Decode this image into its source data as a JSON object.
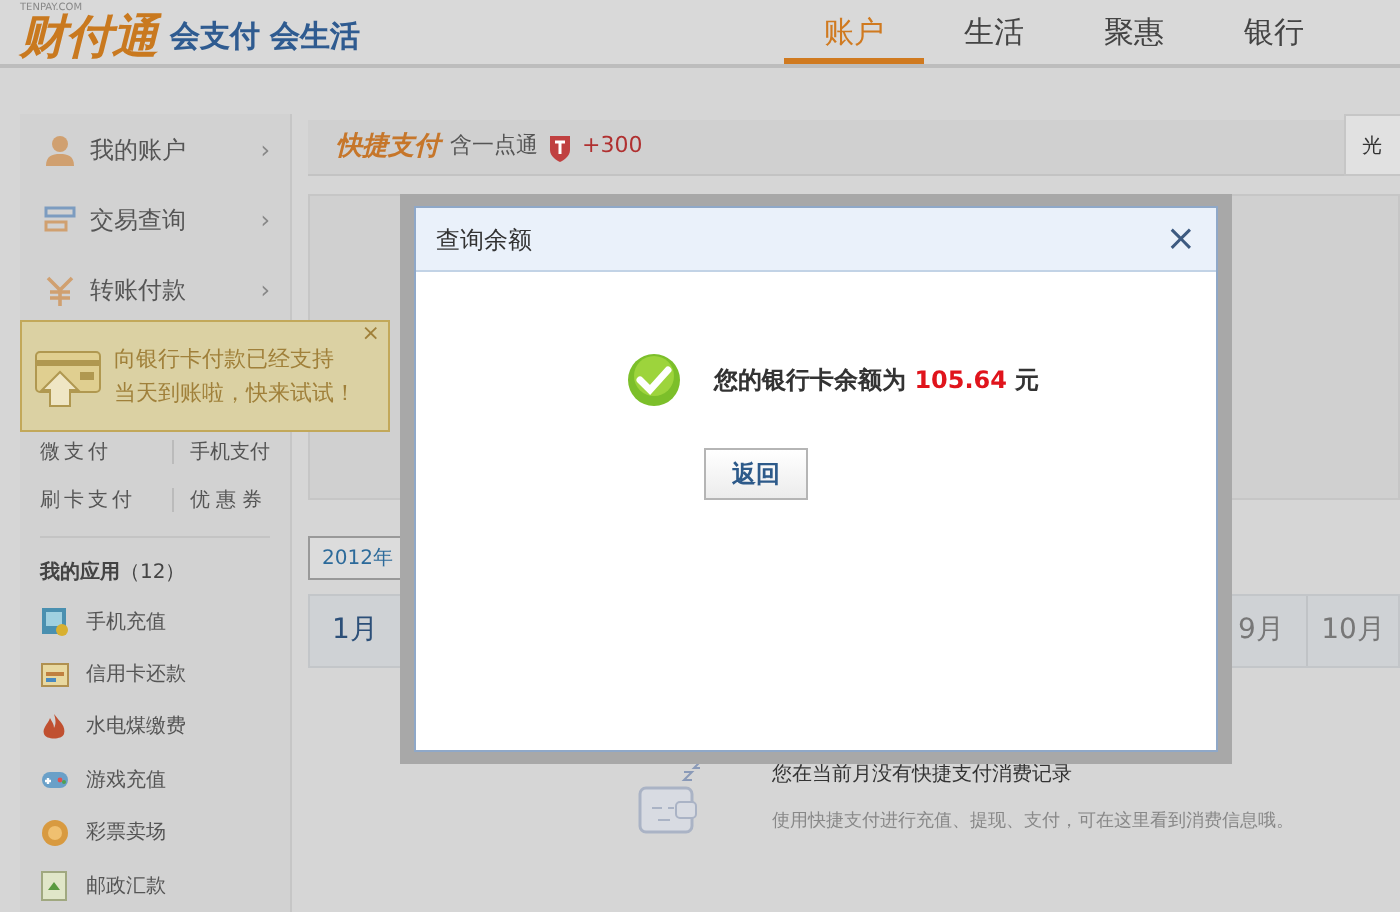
{
  "header": {
    "logo_small": "TENPAY.COM",
    "logo": "财付通",
    "slogan": "会支付 会生活",
    "nav": [
      {
        "label": "账户",
        "selected": true
      },
      {
        "label": "生活",
        "selected": false
      },
      {
        "label": "聚惠",
        "selected": false
      },
      {
        "label": "银行",
        "selected": false
      }
    ]
  },
  "sidebar": {
    "items": [
      {
        "label": "我的账户",
        "kind": "person",
        "chevron": "›"
      },
      {
        "label": "交易查询",
        "kind": "list",
        "chevron": "›"
      },
      {
        "label": "转账付款",
        "kind": "yen",
        "chevron": "›"
      }
    ],
    "tooltip": {
      "lines": [
        "向银行卡付款已经支持",
        "当天到账啦，快来试试！"
      ],
      "close": "×"
    },
    "links": [
      [
        "微支付",
        "手机支付"
      ],
      [
        "刷卡支付",
        "优惠券"
      ]
    ],
    "apps_title": "我的应用",
    "apps_count": "（12）",
    "apps": [
      {
        "label": "手机充值",
        "kind": "phone"
      },
      {
        "label": "信用卡还款",
        "kind": "card"
      },
      {
        "label": "水电煤缴费",
        "kind": "flame"
      },
      {
        "label": "游戏充值",
        "kind": "game"
      },
      {
        "label": "彩票卖场",
        "kind": "lottery"
      },
      {
        "label": "邮政汇款",
        "kind": "post"
      }
    ]
  },
  "main": {
    "brand": "快捷支付",
    "brand_note": "含一点通",
    "bonus": "+300",
    "side_tab": "光",
    "year_tabs": [
      {
        "label": "2012年",
        "selected": true
      }
    ],
    "months_left": [
      "1月"
    ],
    "months_right": [
      "9月",
      "10月"
    ],
    "empty": {
      "title": "您在当前月没有快捷支付消费记录",
      "text": "使用快捷支付进行充值、提现、支付，可在这里看到消费信息哦。"
    }
  },
  "dialog": {
    "title": "查询余额",
    "close": "×",
    "message": "您的银行卡余额为",
    "amount": "105.64",
    "unit": "元",
    "button": "返回"
  }
}
